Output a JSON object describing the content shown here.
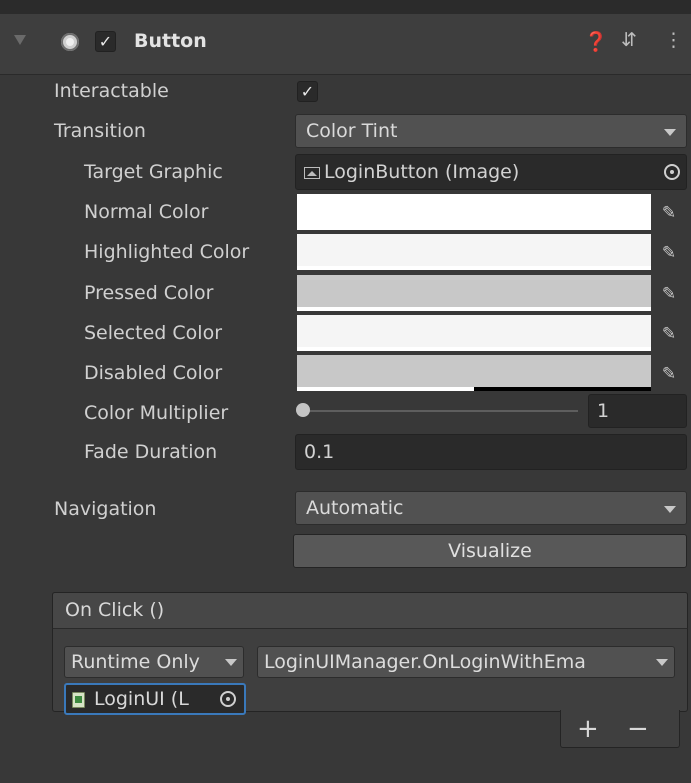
{
  "header": {
    "title": "Button",
    "enabled": true,
    "icons": [
      "help-icon",
      "preset-icon",
      "more-icon"
    ]
  },
  "props": {
    "interactable": {
      "label": "Interactable",
      "checked": true
    },
    "transition": {
      "label": "Transition",
      "value": "Color Tint"
    },
    "target_graphic": {
      "label": "Target Graphic",
      "value": "LoginButton (Image)"
    },
    "colors": [
      {
        "label": "Normal Color",
        "color": "#ffffff",
        "alpha": 1.0
      },
      {
        "label": "Highlighted Color",
        "color": "#f5f5f5",
        "alpha": 1.0
      },
      {
        "label": "Pressed Color",
        "color": "#c8c8c8",
        "alpha": 1.0
      },
      {
        "label": "Selected Color",
        "color": "#f5f5f5",
        "alpha": 1.0
      },
      {
        "label": "Disabled Color",
        "color": "#c8c8c8",
        "alpha": 0.5
      }
    ],
    "color_multiplier": {
      "label": "Color Multiplier",
      "value": "1",
      "slider_fraction": 0.0
    },
    "fade_duration": {
      "label": "Fade Duration",
      "value": "0.1"
    },
    "navigation": {
      "label": "Navigation",
      "value": "Automatic"
    },
    "visualize": {
      "label": "Visualize"
    }
  },
  "on_click": {
    "title": "On Click ()",
    "call_state": "Runtime Only",
    "function": "LoginUIManager.OnLoginWithEma",
    "target": "LoginUI (L",
    "add_label": "+",
    "remove_label": "−"
  }
}
